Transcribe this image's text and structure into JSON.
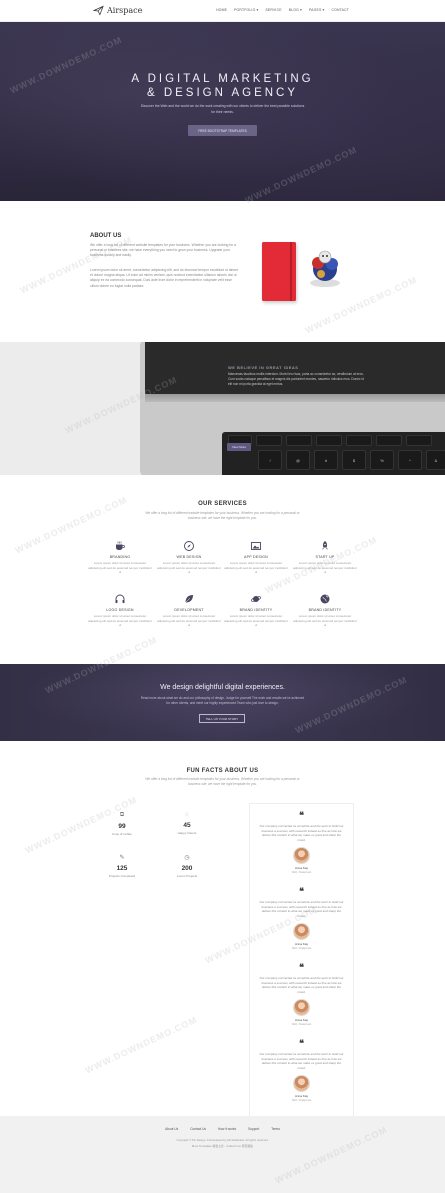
{
  "nav": {
    "brand": "Airspace",
    "items": [
      "HOME",
      "PORTFOLIO ▾",
      "SERVICE",
      "BLOG ▾",
      "PAGES ▾",
      "CONTACT"
    ]
  },
  "hero": {
    "title_line1": "A DIGITAL MARKETING",
    "title_line2": "& DESIGN AGENCY",
    "subtitle": "Discover the Web and the world we do the work creating with our clients to deliver the best possible solutions for their needs.",
    "button": "FREE BOOTSTRAP TEMPLATES"
  },
  "about": {
    "title": "ABOUT US",
    "para1": "We offer a long list of different website templates for your business. Whether you are looking for a personal or business site, we have everything you need to grow your business. Upgrade your business quickly and easily.",
    "para2": "Lorem ipsum dolor sit amet, consectetur adipiscing elit, sed do eiusmod tempor incididunt ut labore et dolore magna aliqua. Ut enim ad minim veniam, quis nostrud exercitation ullamco laboris nisi ut aliquip ex ea commodo consequat. Duis aute irure dolor in reprehenderit in voluptate velit esse cillum dolore eu fugiat nulla pariatur."
  },
  "laptop": {
    "title": "WE BELIEVE IN GREAT IDEAS",
    "para": "Maecenas faucibus mollis interdum. Morbi leo risus, porta ac consectetur ac, vestibulum at eros. Cum sociis natoque penatibus et magnis dis parturient montes, nascetur ridiculus mus. Donec id elit non mi porta gravida at eget metus.",
    "button": "View More"
  },
  "services": {
    "title": "OUR SERVICES",
    "subtitle": "We offer a long list of different website templates for your business. Whether you are looking for a personal or business site, we have the right template for you.",
    "items": [
      {
        "icon": "coffee-cup-icon",
        "title": "BRANDING",
        "desc": "Lorem ipsum dolor sit amet consectetur adipiscing elit sed do eiusmod tempor incididunt ut"
      },
      {
        "icon": "compass-icon",
        "title": "WEB DESIGN",
        "desc": "Lorem ipsum dolor sit amet consectetur adipiscing elit sed do eiusmod tempor incididunt ut"
      },
      {
        "icon": "image-icon",
        "title": "APP DESIGN",
        "desc": "Lorem ipsum dolor sit amet consectetur adipiscing elit sed do eiusmod tempor incididunt ut"
      },
      {
        "icon": "rocket-icon",
        "title": "START UP",
        "desc": "Lorem ipsum dolor sit amet consectetur adipiscing elit sed do eiusmod tempor incididunt ut"
      },
      {
        "icon": "headphones-icon",
        "title": "LOGO DESIGN",
        "desc": "Lorem ipsum dolor sit amet consectetur adipiscing elit sed do eiusmod tempor incididunt ut"
      },
      {
        "icon": "leaf-icon",
        "title": "DEVELOPMENT",
        "desc": "Lorem ipsum dolor sit amet consectetur adipiscing elit sed do eiusmod tempor incididunt ut"
      },
      {
        "icon": "planet-icon",
        "title": "BRAND IDENTITY",
        "desc": "Lorem ipsum dolor sit amet consectetur adipiscing elit sed do eiusmod tempor incididunt ut"
      },
      {
        "icon": "globe-icon",
        "title": "BRAND IDENTITY",
        "desc": "Lorem ipsum dolor sit amet consectetur adipiscing elit sed do eiusmod tempor incididunt ut"
      }
    ]
  },
  "banner": {
    "title": "We design delightful digital experiences.",
    "text": "Read more about what we do and our philosophy of design. Judge for yourself The work and results we've achieved for other clients, and meet our highly experienced Team who just love to design.",
    "button": "TELL US YOUR STORY"
  },
  "facts": {
    "title": "FUN FACTS ABOUT US",
    "subtitle": "We offer a long list of different website templates for your business. Whether you are looking for a personal or business site, we have the right template for you.",
    "items": [
      {
        "icon": "copy-icon",
        "icon_glyph": "⧉",
        "number": "99",
        "label": "Cups of Coffee"
      },
      {
        "icon": "chat-icon",
        "icon_glyph": "◌",
        "number": "45",
        "label": "Happy Clients"
      },
      {
        "icon": "edit-icon",
        "icon_glyph": "✎",
        "number": "125",
        "label": "Projects Completed"
      },
      {
        "icon": "clock-icon",
        "icon_glyph": "◷",
        "number": "200",
        "label": "Lorem Projects"
      }
    ]
  },
  "testimonials": {
    "items": [
      {
        "quote": "Our company connected us somehow and the work to build our business a success, with research indeed as fine as how we deliver this content to what we make us good and sharp the mood.",
        "name": "Anna Kay",
        "role": "CEO, Peakpixels"
      },
      {
        "quote": "Our company connected us somehow and the work to build our business a success, with research indeed as fine as how we deliver this content to what we make us good and sharp the mood.",
        "name": "Anna Kay",
        "role": "CEO, Peakpixels"
      },
      {
        "quote": "Our company connected us somehow and the work to build our business a success, with research indeed as fine as how we deliver this content to what we make us good and sharp the mood.",
        "name": "Anna Kay",
        "role": "CEO, Peakpixels"
      },
      {
        "quote": "Our company connected us somehow and the work to build our business a success, with research indeed as fine as how we deliver this content to what we make us good and sharp the mood.",
        "name": "Anna Kay",
        "role": "CEO, Peakpixels"
      }
    ]
  },
  "footer": {
    "links": [
      "About Us",
      "Contact Us",
      "How it works",
      "Support",
      "Terms"
    ],
    "copy1": "Copyright © Pic Design. A Developed by AirUaniDesks. All rights reserved.",
    "copy2": "More Templates 模板之家 - Collect from 网页模板"
  },
  "watermark": "WWW.DOWNDEMO.COM"
}
